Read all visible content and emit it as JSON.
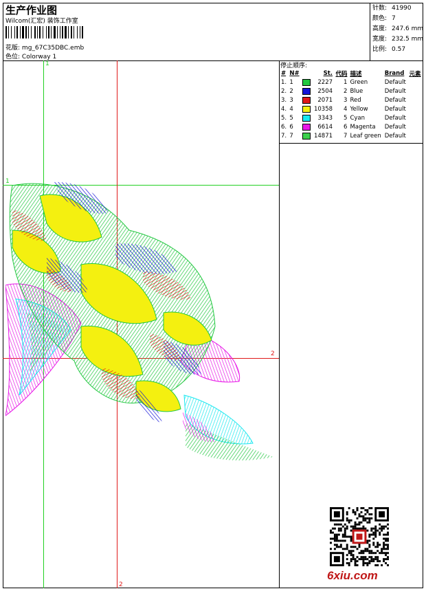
{
  "header": {
    "title": "生产作业图",
    "company": "Wilcom(汇宏) 装饰工作室",
    "design_label": "花版:",
    "design_value": "mg_67C35DBC.emb",
    "colorway_label": "色位:",
    "colorway_value": "Colorway 1"
  },
  "stats": [
    {
      "label": "针数:",
      "value": "41990"
    },
    {
      "label": "颜色:",
      "value": "7"
    },
    {
      "label": "高度:",
      "value": "247.6 mm"
    },
    {
      "label": "宽度:",
      "value": "232.5 mm"
    },
    {
      "label": "比例:",
      "value": "0.57"
    }
  ],
  "stop_sequence": {
    "title": "停止顺序:",
    "columns": [
      "#",
      "N#",
      "St.",
      "代码",
      "描述",
      "Brand",
      "元素"
    ],
    "rows": [
      {
        "idx": "1.",
        "n": "1",
        "color": "#22c840",
        "st": "2227",
        "code": "1",
        "desc": "Green",
        "brand": "Default"
      },
      {
        "idx": "2.",
        "n": "2",
        "color": "#1414d8",
        "st": "2504",
        "code": "2",
        "desc": "Blue",
        "brand": "Default"
      },
      {
        "idx": "3.",
        "n": "3",
        "color": "#e01818",
        "st": "2071",
        "code": "3",
        "desc": "Red",
        "brand": "Default"
      },
      {
        "idx": "4.",
        "n": "4",
        "color": "#f4f010",
        "st": "10358",
        "code": "4",
        "desc": "Yellow",
        "brand": "Default"
      },
      {
        "idx": "5.",
        "n": "5",
        "color": "#18e8f0",
        "st": "3343",
        "code": "5",
        "desc": "Cyan",
        "brand": "Default"
      },
      {
        "idx": "6.",
        "n": "6",
        "color": "#e818e8",
        "st": "6614",
        "code": "6",
        "desc": "Magenta",
        "brand": "Default"
      },
      {
        "idx": "7.",
        "n": "7",
        "color": "#3cd04c",
        "st": "14871",
        "code": "7",
        "desc": "Leaf green",
        "brand": "Default"
      }
    ]
  },
  "guides": {
    "green_top": "1",
    "green_left": "1",
    "red_right": "2",
    "red_bottom": "2",
    "green_color": "#20d020",
    "red_color": "#e01818"
  },
  "watermark": "6xiu.com",
  "icons": {
    "barcode": "barcode-icon",
    "qr": "qr-code-icon",
    "artwork": "embroidery-flower-artwork"
  }
}
